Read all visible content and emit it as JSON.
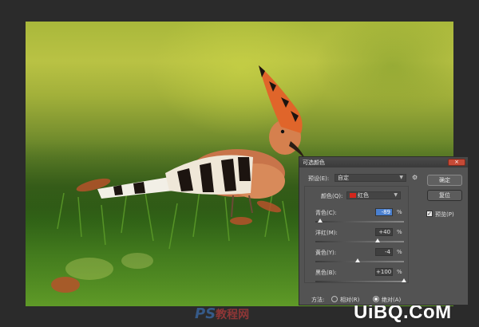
{
  "dialog": {
    "title": "可选颜色",
    "close_label": "×",
    "preset_label": "预设(E):",
    "preset_value": "自定",
    "colors_label": "颜色(Q):",
    "colors_value": "红色",
    "ok_label": "确定",
    "reset_label": "复位",
    "preview_label": "预览(P)",
    "preview_checked": true,
    "sliders": [
      {
        "label": "青色(C):",
        "value": "-89",
        "unit": "%",
        "level": -89
      },
      {
        "label": "洋红(M):",
        "value": "+40",
        "unit": "%",
        "level": 40
      },
      {
        "label": "黄色(Y):",
        "value": "-4",
        "unit": "%",
        "level": -4
      },
      {
        "label": "黑色(B):",
        "value": "+100",
        "unit": "%",
        "level": 100
      }
    ],
    "method_label": "方法:",
    "method_relative": "相对(R)",
    "method_absolute": "绝对(A)",
    "method_selected": "absolute",
    "swatch_color": "#d3261c"
  },
  "watermarks": {
    "ps": "PS",
    "ps_cn": "教程网",
    "site": "UiBQ.CoM"
  },
  "icons": {
    "gear": "gear-icon",
    "dropdown": "chevron-down-icon"
  }
}
